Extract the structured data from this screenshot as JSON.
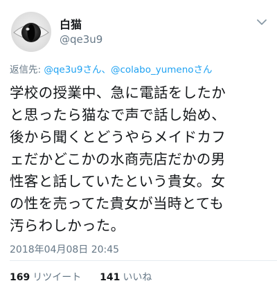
{
  "user": {
    "display_name": "白猫",
    "handle": "@qe3u9",
    "avatar_icon": "cat-eye-avatar"
  },
  "reply": {
    "prefix": "返信先: ",
    "mention1": "@qe3u9さん",
    "separator": "、",
    "mention2": "@colabo_yumenoさん"
  },
  "tweet": {
    "text": "学校の授業中、急に電話をしたか\nと思ったら猫なで声で話し始め、\n後から聞くとどうやらメイドカフ\nェだかどこかの水商売店だかの男\n性客と話していたという貴女。女\nの性を売ってた貴女が当時とても\n汚らわしかった。",
    "timestamp": "2018年04月08日 20:45"
  },
  "stats": {
    "retweets_count": "169",
    "retweets_label": "リツイート",
    "likes_count": "141",
    "likes_label": "いいね"
  },
  "colors": {
    "accent": "#1da1f2",
    "secondary_text": "#657786",
    "primary_text": "#14171a",
    "divider": "#e6ecf0"
  },
  "icons": {
    "menu": "chevron-down-icon"
  }
}
